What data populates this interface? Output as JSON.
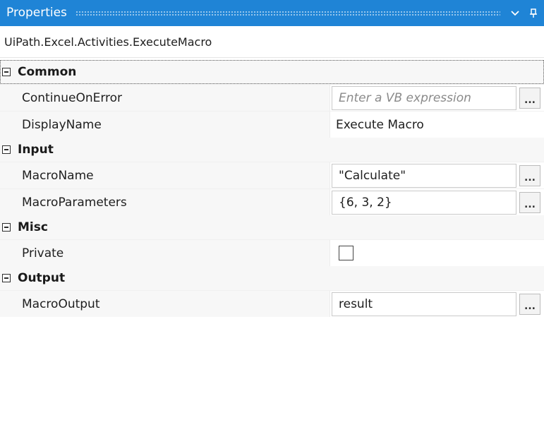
{
  "window": {
    "title": "Properties",
    "dropdown_icon": "chevron-down-icon",
    "pin_icon": "pin-icon"
  },
  "activity_type": "UiPath.Excel.Activities.ExecuteMacro",
  "categories": [
    {
      "label": "Common",
      "properties": [
        {
          "name": "ContinueOnError",
          "value": "",
          "placeholder": "Enter a VB expression"
        },
        {
          "name": "DisplayName",
          "value": "Execute Macro"
        }
      ]
    },
    {
      "label": "Input",
      "properties": [
        {
          "name": "MacroName",
          "value": "\"Calculate\""
        },
        {
          "name": "MacroParameters",
          "value": "{6, 3, 2}"
        }
      ]
    },
    {
      "label": "Misc",
      "properties": [
        {
          "name": "Private",
          "checked": false
        }
      ]
    },
    {
      "label": "Output",
      "properties": [
        {
          "name": "MacroOutput",
          "value": "result"
        }
      ]
    }
  ],
  "ellipsis_label": "...",
  "colors": {
    "titlebar": "#1f84d6",
    "category_bg": "#f7f7f7",
    "text": "#1e1e1e",
    "placeholder": "#8a8a8a"
  }
}
